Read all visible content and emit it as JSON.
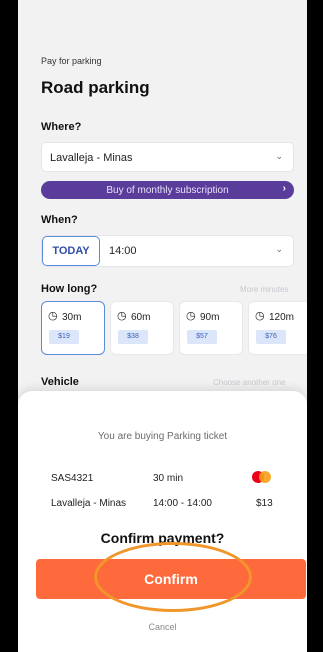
{
  "header": {
    "pre_title": "Pay for parking",
    "title": "Road parking"
  },
  "where": {
    "label": "Where?",
    "value": "Lavalleja - Minas",
    "subscription_label": "Buy of monthly subscription"
  },
  "when": {
    "label": "When?",
    "today_label": "TODAY",
    "time_value": "14:00"
  },
  "how_long": {
    "label": "How long?",
    "more_link": "More minutes",
    "options": [
      {
        "minutes": "30m",
        "price": "$19",
        "selected": true
      },
      {
        "minutes": "60m",
        "price": "$38",
        "selected": false
      },
      {
        "minutes": "90m",
        "price": "$57",
        "selected": false
      },
      {
        "minutes": "120m",
        "price": "$76",
        "selected": false
      }
    ]
  },
  "vehicle": {
    "label": "Vehicle",
    "choose_link": "Choose another one"
  },
  "sheet": {
    "buying_text": "You are buying Parking ticket",
    "plate": "SAS4321",
    "duration": "30 min",
    "location": "Lavalleja - Minas",
    "time_range": "14:00 - 14:00",
    "amount": "$13",
    "card_icon": "mastercard-icon",
    "confirm_question": "Confirm payment?",
    "confirm_label": "Confirm",
    "cancel_label": "Cancel"
  },
  "colors": {
    "accent_orange": "#ff6a3d",
    "subscription_purple": "#5a3c9a",
    "highlight_ring": "#f0962a",
    "selection_blue": "#5b8bd6"
  }
}
